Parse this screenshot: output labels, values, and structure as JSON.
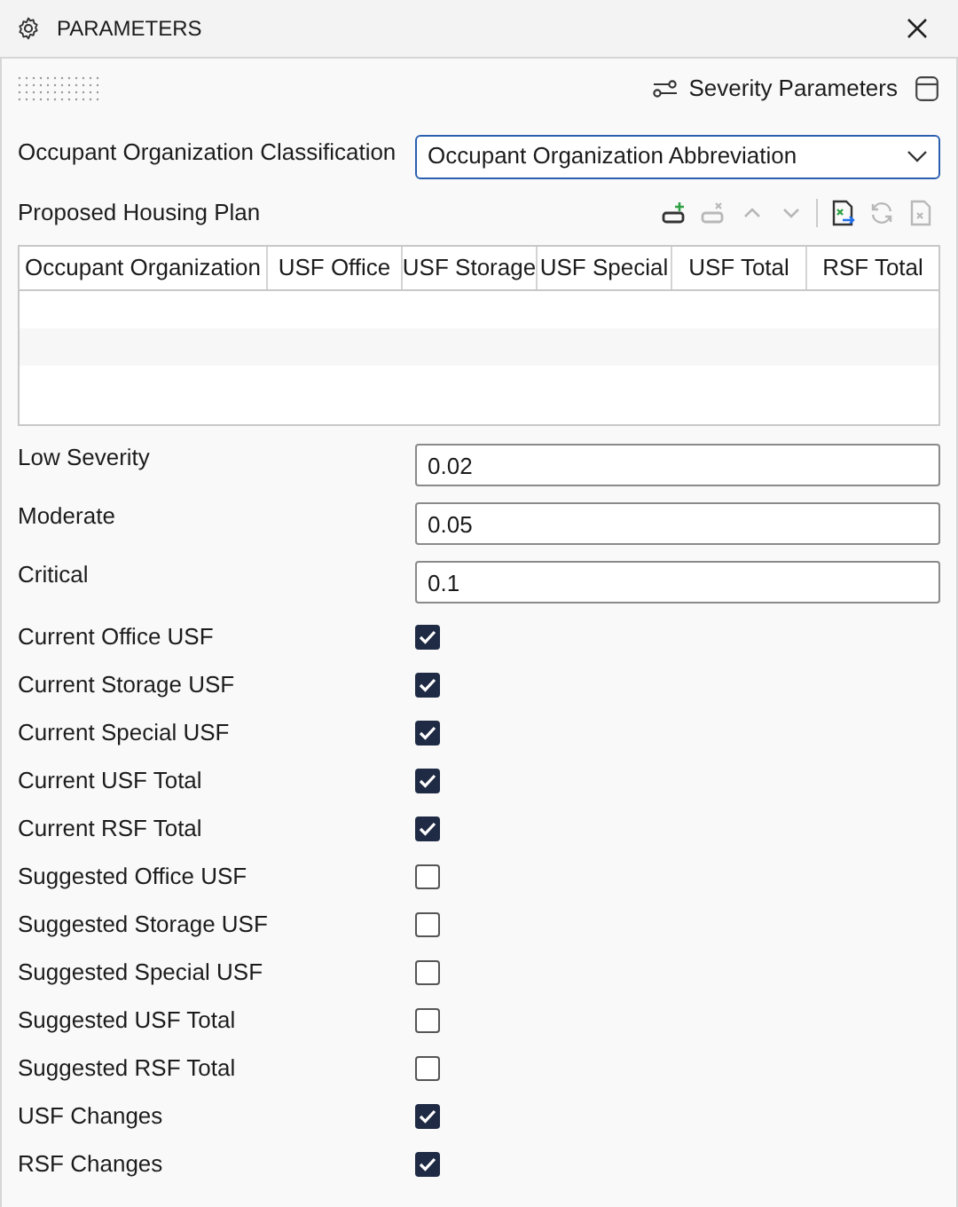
{
  "window": {
    "title": "PARAMETERS"
  },
  "header": {
    "severity_button": "Severity Parameters"
  },
  "classification": {
    "label": "Occupant Organization Classification",
    "value": "Occupant Organization Abbreviation"
  },
  "housing_plan": {
    "title": "Proposed Housing Plan",
    "toolbar": [
      {
        "kind": "add-row",
        "disabled": false
      },
      {
        "kind": "remove-row",
        "disabled": true
      },
      {
        "kind": "up",
        "disabled": true
      },
      {
        "kind": "down",
        "disabled": true
      },
      {
        "kind": "export",
        "disabled": false
      },
      {
        "kind": "refresh",
        "disabled": true
      },
      {
        "kind": "import",
        "disabled": true
      }
    ],
    "columns": [
      "Occupant Organization",
      "USF Office",
      "USF Storage",
      "USF Special",
      "USF Total",
      "RSF Total"
    ]
  },
  "fields": [
    {
      "label": "Low Severity",
      "value": "0.02"
    },
    {
      "label": "Moderate",
      "value": "0.05"
    },
    {
      "label": "Critical",
      "value": "0.1"
    }
  ],
  "options": [
    {
      "label": "Current Office USF",
      "checked": true
    },
    {
      "label": "Current Storage USF",
      "checked": true
    },
    {
      "label": "Current Special USF",
      "checked": true
    },
    {
      "label": "Current USF Total",
      "checked": true
    },
    {
      "label": "Current RSF Total",
      "checked": true
    },
    {
      "label": "Suggested Office USF",
      "checked": false
    },
    {
      "label": "Suggested Storage USF",
      "checked": false
    },
    {
      "label": "Suggested Special USF",
      "checked": false
    },
    {
      "label": "Suggested USF Total",
      "checked": false
    },
    {
      "label": "Suggested RSF Total",
      "checked": false
    },
    {
      "label": "USF Changes",
      "checked": true
    },
    {
      "label": "RSF Changes",
      "checked": true
    }
  ]
}
